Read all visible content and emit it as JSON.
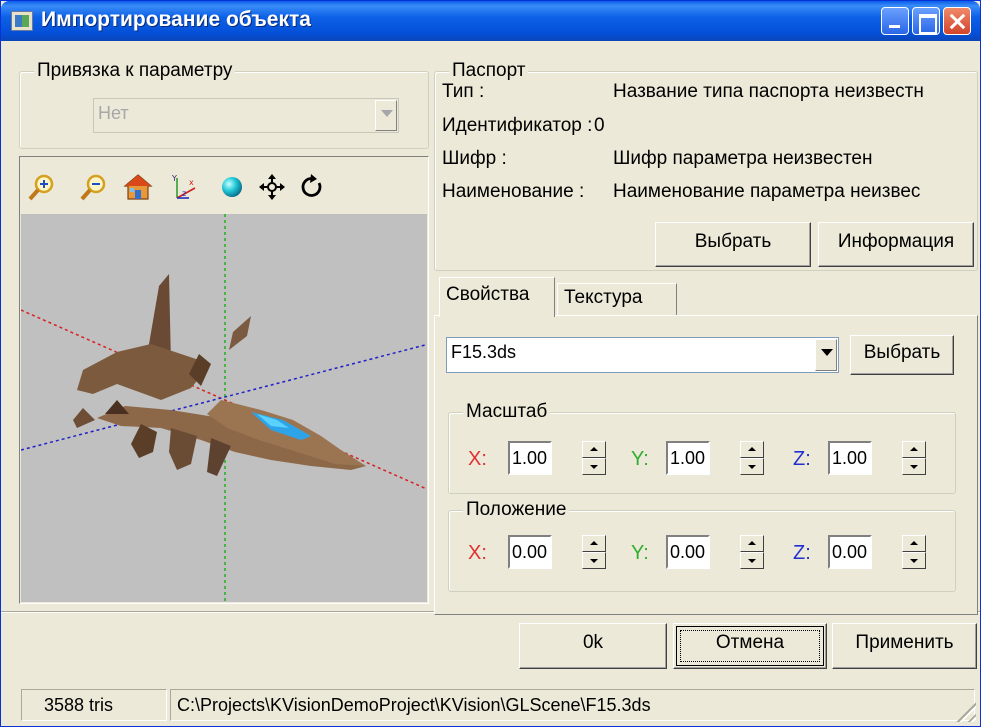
{
  "window": {
    "title": "Импортирование объекта"
  },
  "binding": {
    "group_label": "Привязка к параметру",
    "combo_value": "Нет"
  },
  "viewer": {
    "tools": [
      "zoom-in-icon",
      "zoom-out-icon",
      "home-icon",
      "axes-icon",
      "sphere-icon",
      "move-icon",
      "rotate-icon"
    ]
  },
  "passport": {
    "group_label": "Паспорт",
    "type_label": "Тип :",
    "type_value": "Название типа паспорта неизвестн",
    "id_label": "Идентификатор :",
    "id_value": "0",
    "code_label": "Шифр :",
    "code_value": "Шифр параметра неизвестен",
    "name_label": "Наименование :",
    "name_value": "Наименование параметра неизвес",
    "select_button": "Выбрать",
    "info_button": "Информация"
  },
  "tabs": {
    "properties": "Свойства",
    "texture": "Текстура"
  },
  "properties": {
    "file_value": "F15.3ds",
    "file_button": "Выбрать",
    "scale": {
      "label": "Масштаб",
      "x_label": "X:",
      "y_label": "Y:",
      "z_label": "Z:",
      "x": "1.00",
      "y": "1.00",
      "z": "1.00"
    },
    "position": {
      "label": "Положение",
      "x_label": "X:",
      "y_label": "Y:",
      "z_label": "Z:",
      "x": "0.00",
      "y": "0.00",
      "z": "0.00"
    }
  },
  "buttons": {
    "ok": "0k",
    "cancel": "Отмена",
    "apply": "Применить"
  },
  "status": {
    "tris": "3588 tris",
    "path": "C:\\Projects\\KVisionDemoProject\\KVision\\GLScene\\F15.3ds"
  },
  "colors": {
    "x_axis": "#e03030",
    "y_axis": "#30b030",
    "z_axis": "#2030d0"
  }
}
